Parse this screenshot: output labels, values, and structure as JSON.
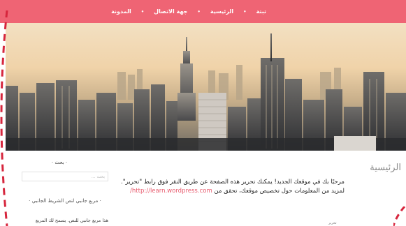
{
  "nav": {
    "items": [
      {
        "label": "تبتة"
      },
      {
        "label": "الرئيسية"
      },
      {
        "label": "جهة الاتصال"
      },
      {
        "label": "المدونة"
      }
    ],
    "separator": "•",
    "background": "#ef6474"
  },
  "hero": {
    "description": "city skyline photo"
  },
  "content": {
    "page_title": "الرئيسية",
    "intro_text": "مرحبًا بك في موقعك الجديد! يمكنك تحرير هذه الصفحة عن طريق النقر فوق رابط \"تحرير\". لمزيد من المعلومات حول تخصيص موقعك، تحقق من",
    "intro_link": "http://learn.wordpress.com/",
    "edit_label": "تحرير",
    "link_color": "#e85a6d"
  },
  "sidebar": {
    "search_title": "· بحث ·",
    "search_placeholder": "بحث ...",
    "widget_title": "· مربع جانبي لنص الشريط الجانبي ·",
    "widget_text": "هذا مربع جانبي للنص. يسمح لك المربع"
  },
  "decor": {
    "dash_color": "#d6263d"
  }
}
